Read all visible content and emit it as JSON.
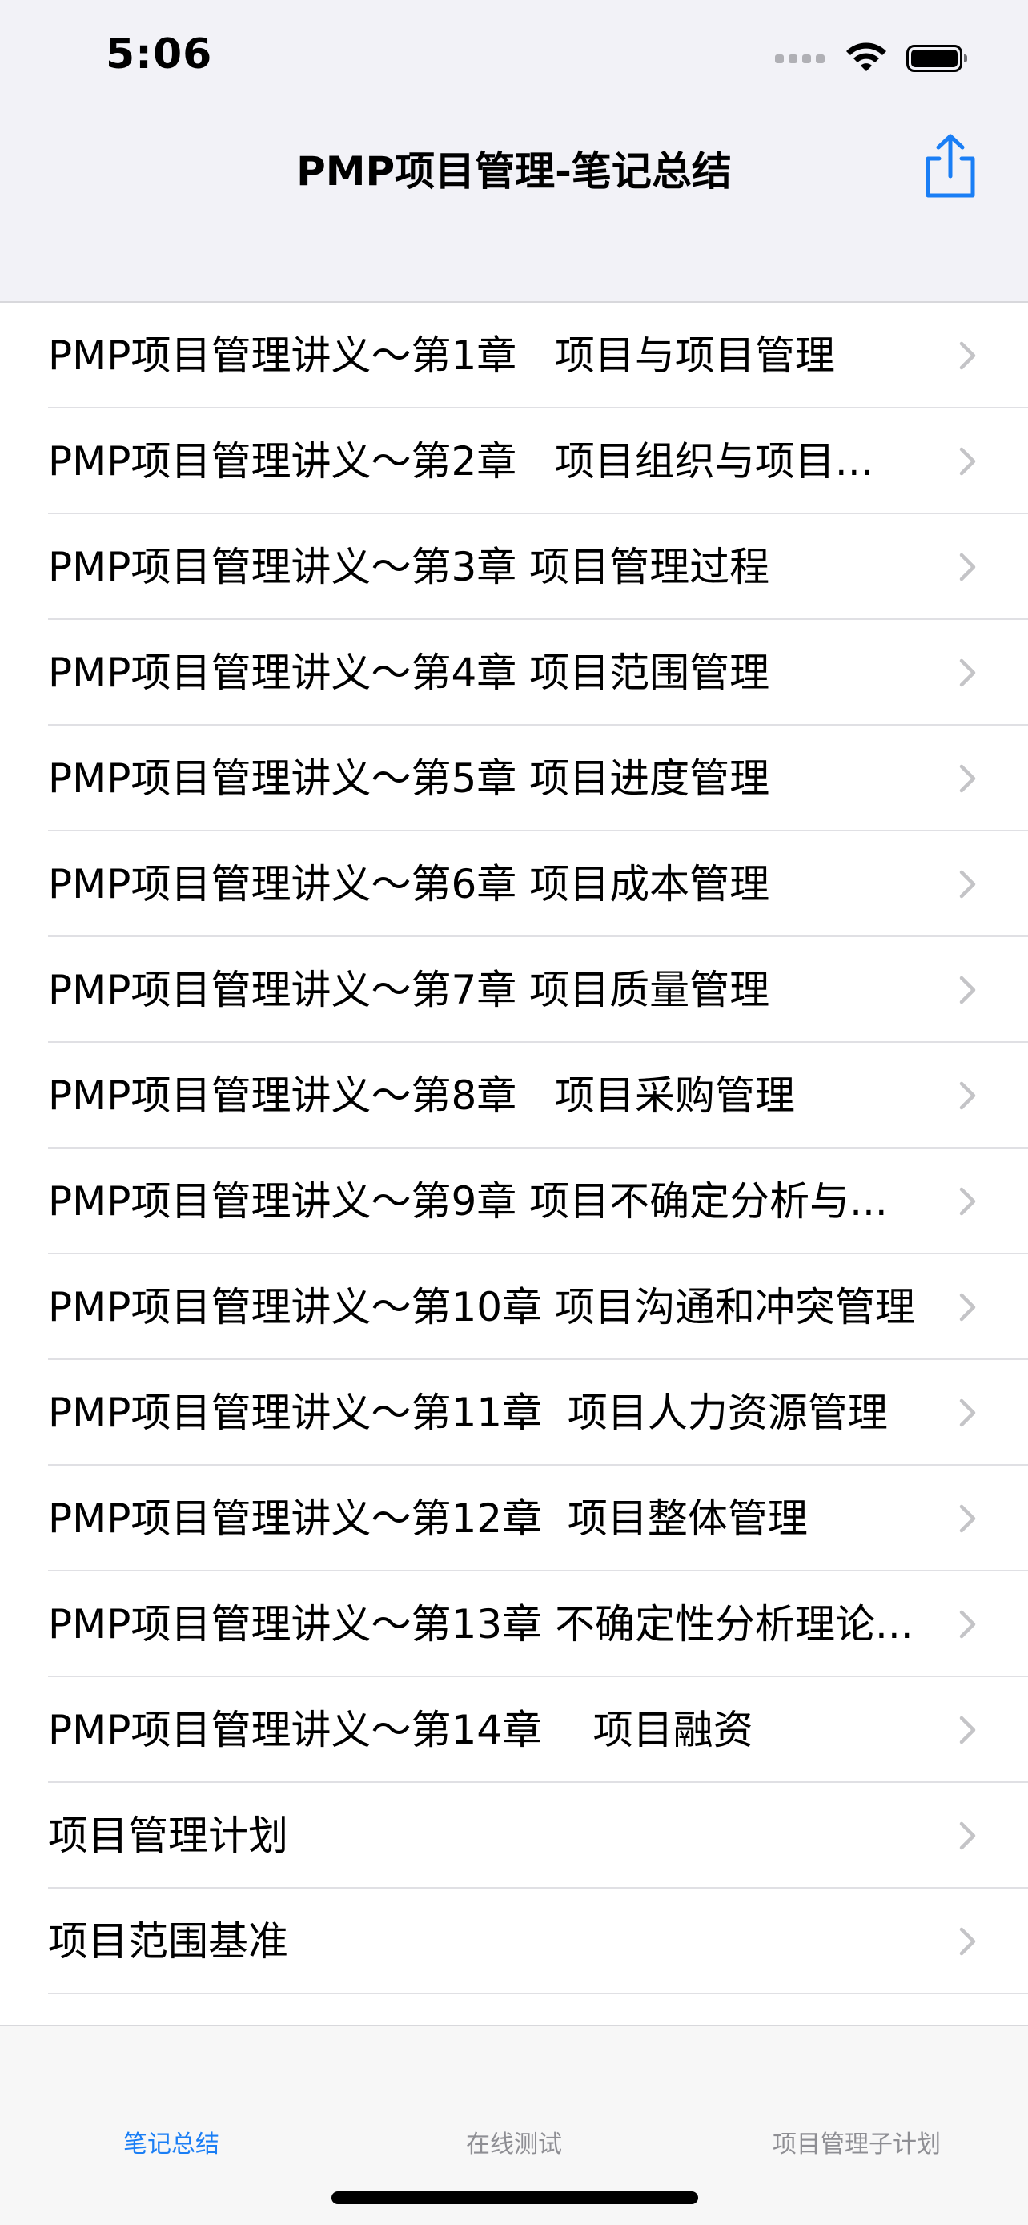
{
  "status_bar": {
    "time": "5:06"
  },
  "nav": {
    "title": "PMP项目管理-笔记总结",
    "share_icon": "share-icon"
  },
  "list": {
    "items": [
      {
        "label": "PMP项目管理讲义～第1章   项目与项目管理"
      },
      {
        "label": "PMP项目管理讲义～第2章   项目组织与项目..."
      },
      {
        "label": "PMP项目管理讲义～第3章 项目管理过程"
      },
      {
        "label": "PMP项目管理讲义～第4章 项目范围管理"
      },
      {
        "label": "PMP项目管理讲义～第5章 项目进度管理"
      },
      {
        "label": "PMP项目管理讲义～第6章 项目成本管理"
      },
      {
        "label": "PMP项目管理讲义～第7章 项目质量管理"
      },
      {
        "label": "PMP项目管理讲义～第8章   项目采购管理"
      },
      {
        "label": "PMP项目管理讲义～第9章 项目不确定分析与..."
      },
      {
        "label": "PMP项目管理讲义～第10章 项目沟通和冲突管理"
      },
      {
        "label": "PMP项目管理讲义～第11章  项目人力资源管理"
      },
      {
        "label": "PMP项目管理讲义～第12章  项目整体管理"
      },
      {
        "label": "PMP项目管理讲义～第13章 不确定性分析理论..."
      },
      {
        "label": "PMP项目管理讲义～第14章    项目融资"
      },
      {
        "label": "项目管理计划"
      },
      {
        "label": "项目范围基准"
      }
    ]
  },
  "tab_bar": {
    "tabs": [
      {
        "label": "笔记总结",
        "active": true
      },
      {
        "label": "在线测试",
        "active": false
      },
      {
        "label": "项目管理子计划",
        "active": false
      }
    ]
  },
  "colors": {
    "accent": "#1a7ef5",
    "nav_background": "#f2f2f7",
    "tab_inactive": "#8e8e93",
    "separator": "#e0e0e4",
    "chevron": "#c4c4c7"
  }
}
